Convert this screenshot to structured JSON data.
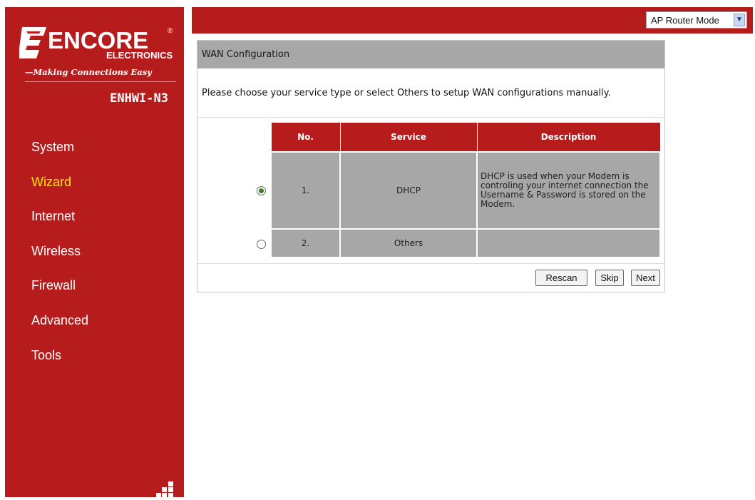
{
  "brand": {
    "logo_text": "ENCORE",
    "logo_sub": "ELECTRONICS",
    "tagline": "Making Connections Easy",
    "model": "ENHWI-N3",
    "color": "#b71c1c"
  },
  "sidebar": {
    "items": [
      {
        "label": "System"
      },
      {
        "label": "Wizard",
        "active": true
      },
      {
        "label": "Internet"
      },
      {
        "label": "Wireless"
      },
      {
        "label": "Firewall"
      },
      {
        "label": "Advanced"
      },
      {
        "label": "Tools"
      }
    ]
  },
  "topbar": {
    "mode_value": "AP Router Mode"
  },
  "wan": {
    "title": "WAN Configuration",
    "instruction": "Please choose your service type or select Others to setup WAN configurations manually.",
    "columns": {
      "no": "No.",
      "service": "Service",
      "description": "Description"
    },
    "rows": [
      {
        "no": "1.",
        "service": "DHCP",
        "description": "DHCP is used when your Modem is controling your internet connection the Username & Password is stored on the Modem.",
        "selected": true
      },
      {
        "no": "2.",
        "service": "Others",
        "description": "",
        "selected": false
      }
    ],
    "buttons": {
      "rescan": "Rescan",
      "skip": "Skip",
      "next": "Next"
    }
  }
}
